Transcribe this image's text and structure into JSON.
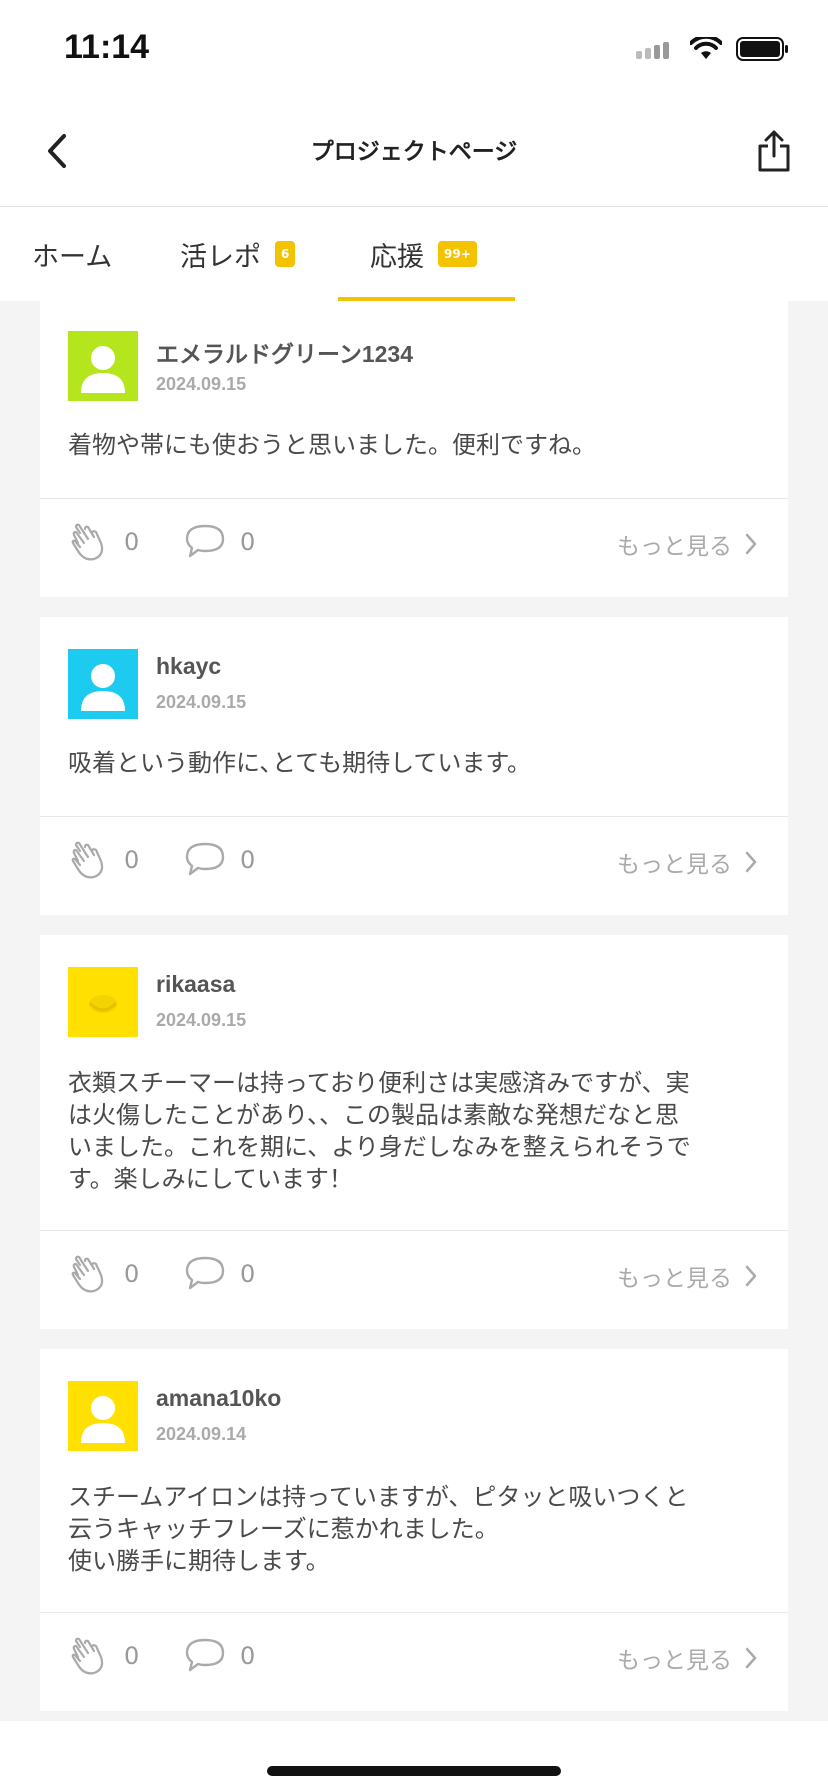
{
  "status": {
    "time": "11:14"
  },
  "nav": {
    "title": "プロジェクトページ"
  },
  "tabs": [
    {
      "label": "ホーム",
      "badge": ""
    },
    {
      "label": "活レポ",
      "badge": "6"
    },
    {
      "label": "応援",
      "badge": "99+"
    }
  ],
  "active_tab": "応援",
  "colors": {
    "accent": "#f0c200",
    "avatar_green": "#b5e61d",
    "avatar_cyan": "#1ecbf0",
    "avatar_yellow": "#ffe000"
  },
  "posts": [
    {
      "username": "エメラルドグリーン1234",
      "date": "2024.09.15",
      "comment": "着物や帯にも使おうと思いました。便利ですね。",
      "claps": "0",
      "replies": "0",
      "more": "もっと見る",
      "avatar": "person-icon"
    },
    {
      "username": "hkayc",
      "date": "2024.09.15",
      "comment": "吸着という動作に､とても期待しています。",
      "claps": "0",
      "replies": "0",
      "more": "もっと見る",
      "avatar": "person-icon"
    },
    {
      "username": "rikaasa",
      "date": "2024.09.15",
      "comment": "衣類スチーマーは持っており便利さは実感済みですが、実\nは火傷したことがあり、、この製品は素敵な発想だなと思\nいました。これを期に、より身だしなみを整えられそうで\nす。楽しみにしています！",
      "claps": "0",
      "replies": "0",
      "more": "もっと見る",
      "avatar": "photo-avatar"
    },
    {
      "username": "amana10ko",
      "date": "2024.09.14",
      "comment": "スチームアイロンは持っていますが、ピタッと吸いつくと\n云うキャッチフレーズに惹かれました。\n使い勝手に期待します。",
      "claps": "0",
      "replies": "0",
      "more": "もっと見る",
      "avatar": "person-icon"
    }
  ]
}
